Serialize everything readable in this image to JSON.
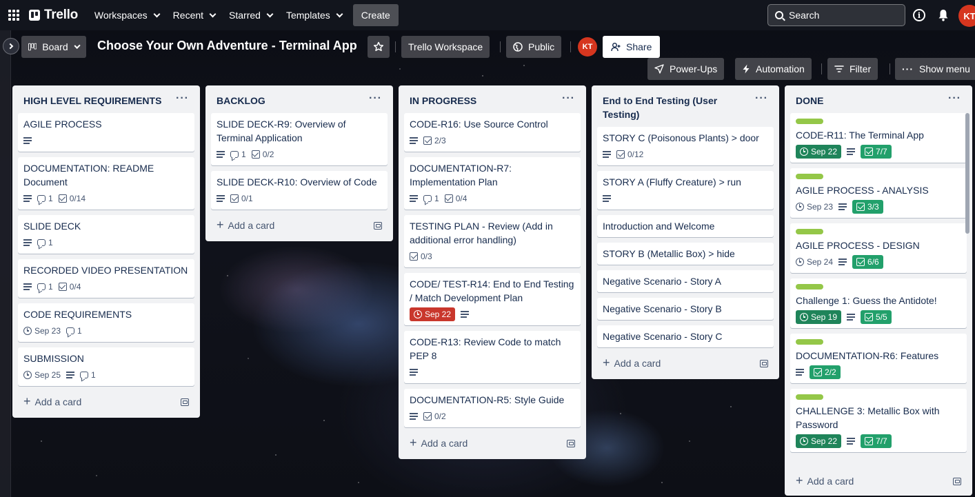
{
  "nav": {
    "logo": "Trello",
    "items": [
      {
        "label": "Workspaces"
      },
      {
        "label": "Recent"
      },
      {
        "label": "Starred"
      },
      {
        "label": "Templates"
      }
    ],
    "create": "Create",
    "search_placeholder": "Search",
    "avatar": "KT"
  },
  "header": {
    "view": "Board",
    "title": "Choose Your Own Adventure - Terminal App",
    "workspace": "Trello Workspace",
    "visibility": "Public",
    "member": "KT",
    "share": "Share",
    "power_ups": "Power-Ups",
    "automation": "Automation",
    "filter": "Filter",
    "show_menu": "Show menu"
  },
  "add_card_label": "Add a card",
  "lists": [
    {
      "title": "HIGH LEVEL REQUIREMENTS",
      "cards": [
        {
          "title": "AGILE PROCESS",
          "desc": true
        },
        {
          "title": "DOCUMENTATION: README Document",
          "desc": true,
          "comments": "1",
          "checklist": "0/14"
        },
        {
          "title": "SLIDE DECK",
          "desc": true,
          "comments": "1"
        },
        {
          "title": "RECORDED VIDEO PRESENTATION",
          "desc": true,
          "comments": "1",
          "checklist": "0/4"
        },
        {
          "title": "CODE REQUIREMENTS",
          "due": "Sep 23",
          "comments": "1"
        },
        {
          "title": "SUBMISSION",
          "due": "Sep 25",
          "desc": true,
          "comments": "1"
        }
      ]
    },
    {
      "title": "BACKLOG",
      "cards": [
        {
          "title": "SLIDE DECK-R9: Overview of Terminal Application",
          "desc": true,
          "comments": "1",
          "checklist": "0/2"
        },
        {
          "title": "SLIDE DECK-R10: Overview of Code",
          "desc": true,
          "checklist": "0/1"
        }
      ]
    },
    {
      "title": "IN PROGRESS",
      "cards": [
        {
          "title": "CODE-R16: Use Source Control",
          "desc": true,
          "checklist": "2/3"
        },
        {
          "title": "DOCUMENTATION-R7: Implementation Plan",
          "desc": true,
          "comments": "1",
          "checklist": "0/4"
        },
        {
          "title": "TESTING PLAN - Review (Add in additional error handling)",
          "checklist": "0/3"
        },
        {
          "title": "CODE/ TEST-R14: End to End Testing / Match Development Plan",
          "due": "Sep 22",
          "due_state": "overdue",
          "desc": true
        },
        {
          "title": "CODE-R13: Review Code to match PEP 8",
          "desc": true
        },
        {
          "title": "DOCUMENTATION-R5: Style Guide",
          "desc": true,
          "checklist": "0/2"
        }
      ]
    },
    {
      "title": "End to End Testing (User Testing)",
      "cards": [
        {
          "title": "STORY C (Poisonous Plants) > door",
          "desc": true,
          "checklist": "0/12"
        },
        {
          "title": "STORY A (Fluffy Creature) > run",
          "desc": true
        },
        {
          "title": "Introduction and Welcome"
        },
        {
          "title": "STORY B (Metallic Box) > hide"
        },
        {
          "title": "Negative Scenario - Story A"
        },
        {
          "title": "Negative Scenario - Story B"
        },
        {
          "title": "Negative Scenario - Story C"
        }
      ]
    },
    {
      "title": "DONE",
      "cards": [
        {
          "title": "CODE-R11: The Terminal App",
          "label": "#94c748",
          "due": "Sep 22",
          "due_state": "complete",
          "desc": true,
          "checklist": "7/7",
          "checklist_state": "complete"
        },
        {
          "title": "AGILE PROCESS - ANALYSIS",
          "label": "#94c748",
          "due": "Sep 23",
          "desc": true,
          "checklist": "3/3",
          "checklist_state": "complete"
        },
        {
          "title": "AGILE PROCESS - DESIGN",
          "label": "#94c748",
          "due": "Sep 24",
          "desc": true,
          "checklist": "6/6",
          "checklist_state": "complete"
        },
        {
          "title": "Challenge 1: Guess the Antidote!",
          "label": "#94c748",
          "due": "Sep 19",
          "due_state": "complete",
          "desc": true,
          "checklist": "5/5",
          "checklist_state": "complete"
        },
        {
          "title": "DOCUMENTATION-R6: Features",
          "label": "#94c748",
          "desc": true,
          "checklist": "2/2",
          "checklist_state": "complete"
        },
        {
          "title": "CHALLENGE 3: Metallic Box with Password",
          "label": "#94c748",
          "due": "Sep 22",
          "due_state": "complete",
          "desc": true,
          "checklist": "7/7",
          "checklist_state": "complete"
        }
      ]
    }
  ]
}
